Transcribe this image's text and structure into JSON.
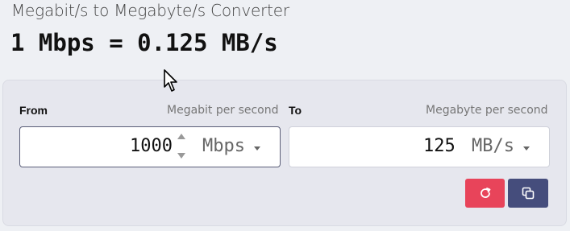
{
  "title": "Megabit/s to Megabyte/s Converter",
  "result": "1 Mbps = 0.125 MB/s",
  "from": {
    "label": "From",
    "unit_desc": "Megabit per second",
    "value": "1000",
    "unit": "Mbps"
  },
  "to": {
    "label": "To",
    "unit_desc": "Megabyte per second",
    "value": "125",
    "unit": "MB/s"
  },
  "colors": {
    "reset_button": "#e8445a",
    "copy_button": "#454d7c",
    "active_border": "#5a5e78"
  },
  "icons": {
    "reset": "refresh-icon",
    "copy": "copy-icon",
    "cursor": "mouse-pointer-icon"
  }
}
